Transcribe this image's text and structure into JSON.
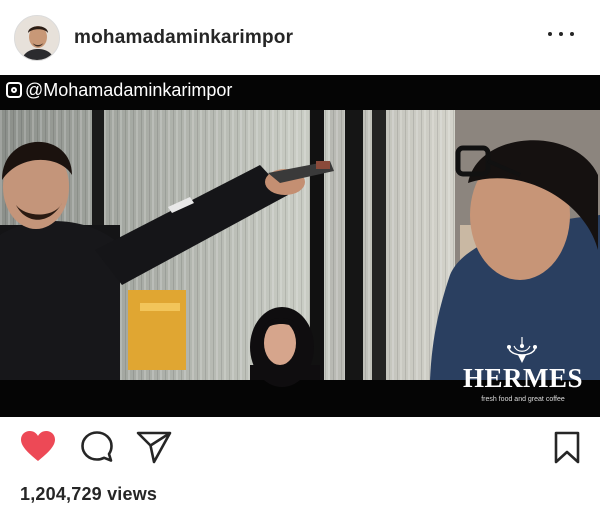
{
  "post": {
    "username": "mohamadaminkarimpor",
    "views": "1,204,729 views"
  },
  "media": {
    "overlay_handle": "@Mohamadaminkarimpor",
    "brand_name": "HERMES",
    "brand_tagline": "fresh food and great coffee"
  },
  "icons": {
    "more": "more-options-icon",
    "like": "heart-filled-icon",
    "comment": "comment-icon",
    "share": "share-icon",
    "save": "bookmark-icon",
    "overlay": "instagram-logo-icon"
  },
  "colors": {
    "like": "#ed4956",
    "text": "#262626",
    "media_bg": "#050505"
  }
}
